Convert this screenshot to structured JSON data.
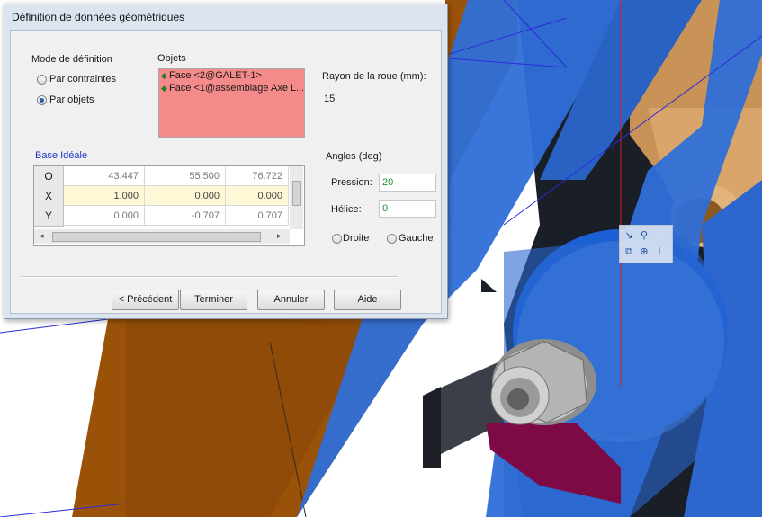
{
  "dialog": {
    "title": "Définition de données géométriques",
    "mode_group": {
      "label": "Mode de définition",
      "options": [
        "Par contraintes",
        "Par objets"
      ],
      "selected": "Par objets"
    },
    "objets": {
      "label": "Objets",
      "items": [
        "Face <2@GALET-1>",
        "Face <1@assemblage Axe L..."
      ]
    },
    "rayon": {
      "label": "Rayon de la roue (mm):",
      "value": "15"
    },
    "base": {
      "label": "Base Idéale",
      "rows": [
        {
          "h": "O",
          "c": [
            "43.447",
            "55.500",
            "76.722"
          ]
        },
        {
          "h": "X",
          "c": [
            "1.000",
            "0.000",
            "0.000"
          ]
        },
        {
          "h": "Y",
          "c": [
            "0.000",
            "-0.707",
            "0.707"
          ]
        }
      ]
    },
    "angles": {
      "label": "Angles (deg)",
      "pression_label": "Pression:",
      "pression_value": "20",
      "helice_label": "Hélice:",
      "helice_value": "0",
      "dir_options": [
        "Droite",
        "Gauche"
      ]
    },
    "buttons": {
      "prev": "< Précédent",
      "finish": "Terminer",
      "cancel": "Annuler",
      "help": "Aide"
    }
  },
  "colors": {
    "orange": "#9a5208",
    "blue": "#2f6fd8",
    "light_blue": "#5c95e6",
    "tan": "#c99256",
    "dark": "#1a1e26",
    "magenta": "#7e0a45",
    "list_bg": "#f58a8a"
  }
}
